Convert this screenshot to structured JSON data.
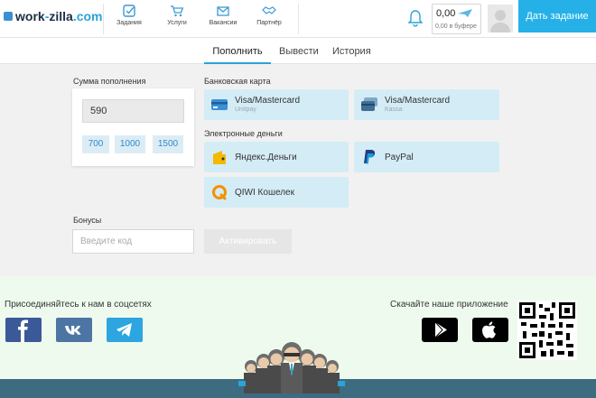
{
  "header": {
    "logo_part1": "work",
    "logo_dash": "-",
    "logo_part2": "zilla",
    "logo_domain": ".com",
    "nav": [
      {
        "label": "Задания",
        "icon": "checkbox-icon"
      },
      {
        "label": "Услуги",
        "icon": "cart-icon"
      },
      {
        "label": "Вакансии",
        "icon": "envelope-icon"
      },
      {
        "label": "Партнёр",
        "icon": "handshake-icon"
      }
    ],
    "balance_amount": "0,00",
    "balance_buffer": "0,00 в буфере",
    "cta_label": "Дать задание"
  },
  "tabs": [
    {
      "label": "Пополнить",
      "active": true
    },
    {
      "label": "Вывести",
      "active": false
    },
    {
      "label": "История",
      "active": false
    }
  ],
  "topup": {
    "section_label": "Сумма пополнения",
    "amount_value": "590",
    "quick_amounts": [
      "700",
      "1000",
      "1500"
    ]
  },
  "payment": {
    "bank_label": "Банковская карта",
    "emoney_label": "Электронные деньги",
    "methods": [
      {
        "title": "Visa/Mastercard",
        "subtitle": "Unitpay",
        "icon": "credit-card-icon"
      },
      {
        "title": "Visa/Mastercard",
        "subtitle": "Kassa",
        "icon": "credit-cards-icon"
      },
      {
        "title": "Яндекс.Деньги",
        "subtitle": "",
        "icon": "yandex-money-icon"
      },
      {
        "title": "PayPal",
        "subtitle": "",
        "icon": "paypal-icon"
      },
      {
        "title": "QIWI Кошелек",
        "subtitle": "",
        "icon": "qiwi-icon"
      }
    ]
  },
  "bonus": {
    "label": "Бонусы",
    "placeholder": "Введите код",
    "button_label": "Активировать"
  },
  "footer": {
    "social_label": "Присоединяйтесь к нам в соцсетях",
    "app_label": "Скачайте наше приложение",
    "social_icons": [
      "facebook-icon",
      "vk-icon",
      "telegram-icon"
    ],
    "store_icons": [
      "google-play-icon",
      "apple-icon"
    ]
  },
  "colors": {
    "accent": "#25b1e8",
    "tile": "#d4ecf5",
    "footer_bg": "#effaef",
    "footer_bar": "#3d6b80",
    "facebook": "#3b5998",
    "vk": "#4c75a3",
    "telegram": "#2ca5e0"
  }
}
